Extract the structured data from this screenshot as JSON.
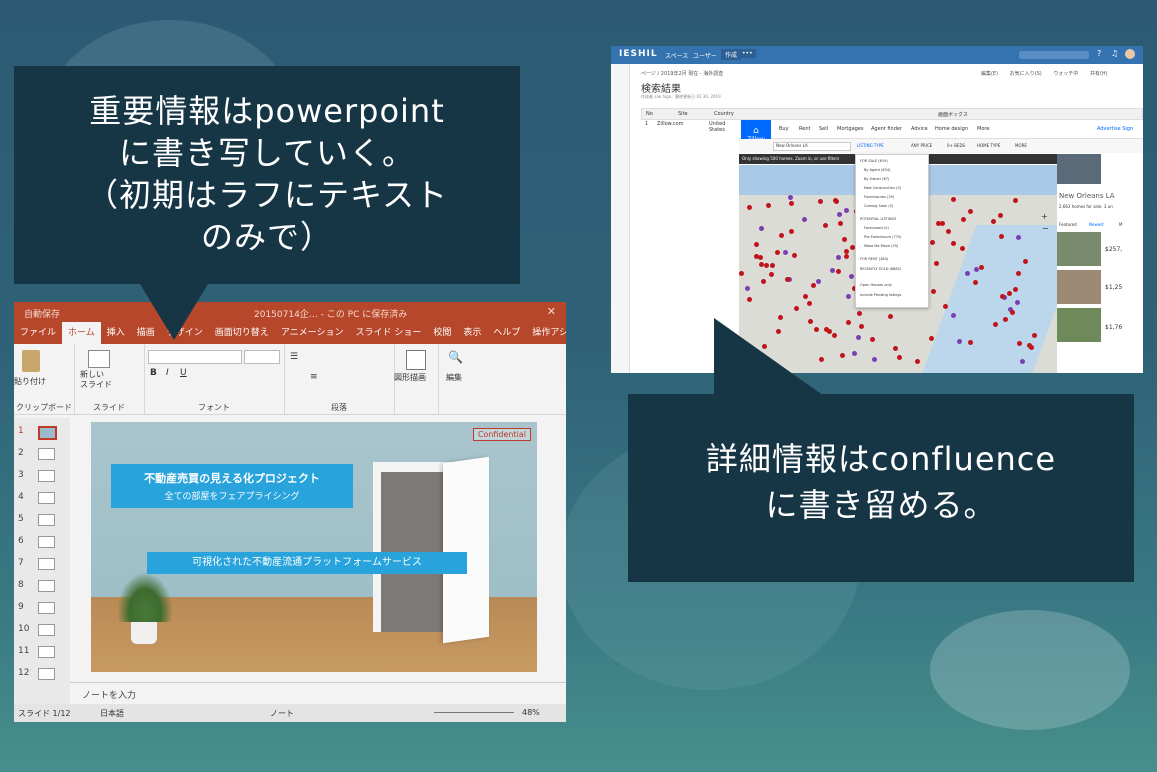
{
  "callout_left": {
    "lines": [
      "重要情報はpowerpoint",
      "に書き写していく。",
      "（初期はラフにテキスト",
      "のみで）"
    ]
  },
  "callout_right": {
    "lines": [
      "詳細情報はconfluence",
      "に書き留める。"
    ]
  },
  "ppt": {
    "title": "20150714企… - この PC に保存済み",
    "title_left": "自動保存",
    "tabs": [
      "ファイル",
      "ホーム",
      "挿入",
      "描画",
      "デザイン",
      "画面切り替え",
      "アニメーション",
      "スライド ショー",
      "校閲",
      "表示",
      "ヘルプ",
      "操作アシス"
    ],
    "ribbon": {
      "paste": "貼り付け",
      "clipboard": "クリップボード",
      "new_slide": "新しい\nスライド",
      "slides": "スライド",
      "font": "フォント",
      "paragraph": "段落",
      "drawing": "図形描画",
      "editing": "編集"
    },
    "thumb_numbers": [
      "1",
      "2",
      "3",
      "4",
      "5",
      "6",
      "7",
      "8",
      "9",
      "10",
      "11",
      "12"
    ],
    "slide": {
      "confidential": "Confidential",
      "title": "不動産売買の見える化プロジェクト",
      "subtitle": "全ての部屋をフェアプライシング",
      "band": "可視化された不動産流通プラットフォームサービス"
    },
    "notes_placeholder": "ノートを入力",
    "status": {
      "slide": "スライド 1/12",
      "lang": "日本語",
      "notes": "ノート",
      "zoom": "48%"
    }
  },
  "confluence": {
    "logo": "IESHIL",
    "nav": [
      "スペース",
      "ユーザー",
      "作成",
      "•••"
    ],
    "breadcrumb": "ページ / 2019年2月 現在 - 海外調査",
    "actions": [
      "編集(E)",
      "お気に入り(S)",
      "ウォッチ中",
      "共有(H)"
    ],
    "page_title": "検索結果",
    "meta": "作成者 sae higa、最終更新日 02 30, 2019",
    "table_headers": [
      "No",
      "Site",
      "Country",
      "画面ボックス"
    ],
    "row": {
      "no": "1",
      "site": "Zillow.com",
      "country": "United States"
    }
  },
  "zillow": {
    "logo": "Zillow",
    "nav": [
      "Buy",
      "Rent",
      "Sell",
      "Mortgages",
      "Agent finder",
      "Advice",
      "Home design",
      "More"
    ],
    "nav_right": "Advertise  Sign",
    "search_value": "New Orleans LA",
    "filters": [
      "LISTING TYPE",
      "ANY PRICE",
      "0+ BEDS",
      "HOME TYPE",
      "MORE"
    ],
    "banner": "Only showing 500 homes. Zoom in, or use filters",
    "dropdown": [
      "FOR SALE (619)",
      "By Agent (834)",
      "By Owner (67)",
      "New Construction (0)",
      "Foreclosures (29)",
      "Coming Soon (2)",
      "POTENTIAL LISTINGS",
      "Foreclosed (0)",
      "Pre-Foreclosure (770)",
      "Make Me Move (25)",
      "FOR RENT (484)",
      "RECENTLY SOLD (6882)",
      "Open Houses only",
      "Include Pending listings"
    ],
    "side_title": "New Orleans LA",
    "side_count": "2,663 homes for sale. 3 un",
    "side_tabs": [
      "Featured",
      "Newest",
      "M"
    ],
    "prices": [
      "$257,",
      "$1,25",
      "$1,76"
    ]
  },
  "colors": {
    "ppt_accent": "#b7472a",
    "callout_bg": "#163645",
    "confluence_nav": "#3572b0",
    "zillow_blue": "#006aff",
    "slide_band": "#29a3dc"
  }
}
